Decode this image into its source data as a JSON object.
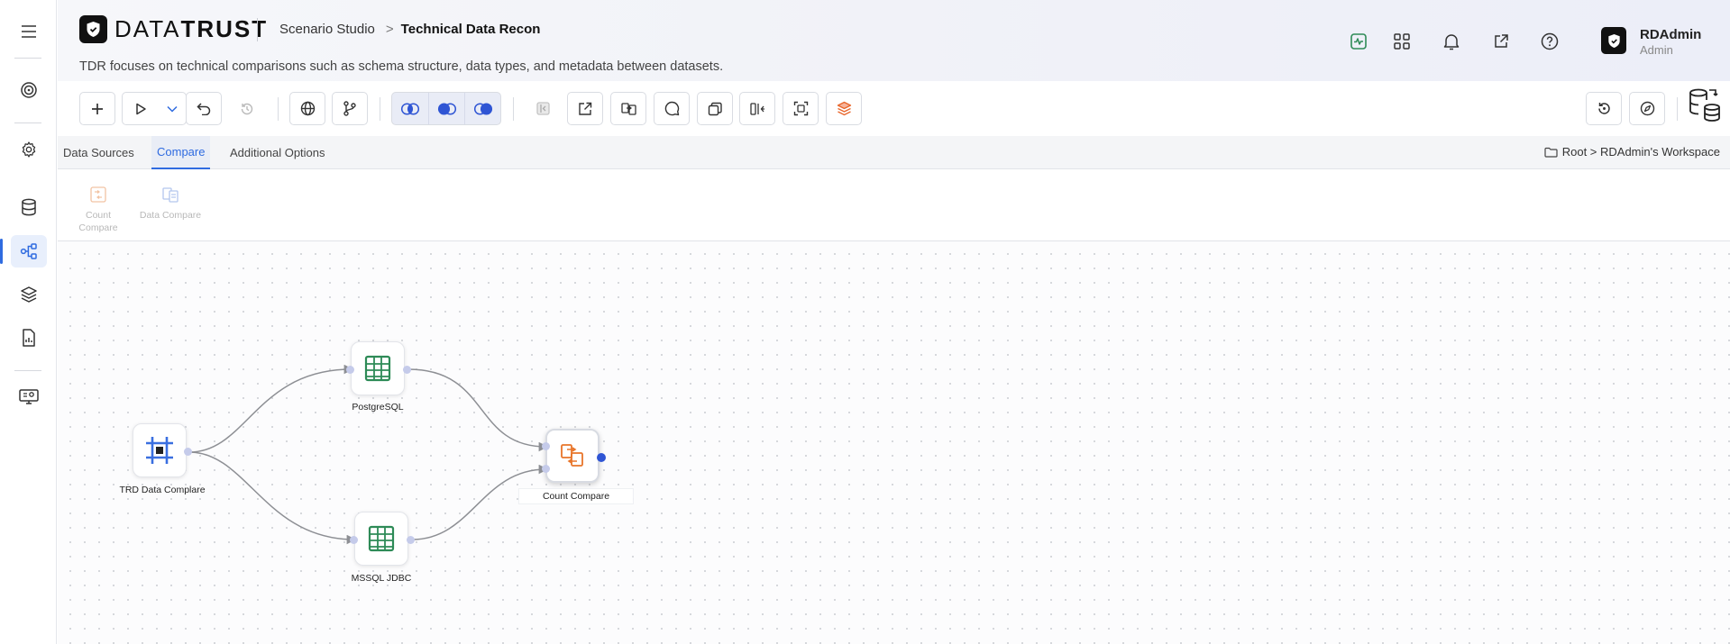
{
  "app": {
    "brand_light": "DATA",
    "brand_bold": "TRUST",
    "breadcrumb": [
      "Scenario Studio",
      "Technical Data Recon"
    ],
    "subtitle": "TDR focuses on technical comparisons such as schema structure, data types, and metadata between datasets."
  },
  "sidebar": {
    "items": [
      {
        "icon": "menu-icon"
      },
      {
        "icon": "target-icon"
      },
      {
        "icon": "gear-icon"
      },
      {
        "icon": "database-icon"
      },
      {
        "icon": "flow-icon",
        "active": true
      },
      {
        "icon": "layers-icon"
      },
      {
        "icon": "report-icon"
      },
      {
        "icon": "monitor-settings-icon"
      }
    ]
  },
  "header_icons": [
    "activity-icon",
    "grid-icon",
    "bell-icon",
    "external-link-icon",
    "help-icon"
  ],
  "user": {
    "name": "RDAdmin",
    "role": "Admin"
  },
  "tabs": [
    {
      "label": "Data Sources",
      "active": false
    },
    {
      "label": "Compare",
      "active": true
    },
    {
      "label": "Additional Options",
      "active": false
    }
  ],
  "workspace_path": "Root > RDAdmin's Workspace",
  "palette": [
    {
      "label": "Count Compare"
    },
    {
      "label": "Data Compare"
    }
  ],
  "nodes": [
    {
      "id": "trd",
      "label": "TRD Data Complare",
      "icon": "frame-icon"
    },
    {
      "id": "pg",
      "label": "PostgreSQL",
      "icon": "table-icon"
    },
    {
      "id": "mssql",
      "label": "MSSQL JDBC",
      "icon": "table-icon"
    },
    {
      "id": "cc",
      "label": "Count Compare",
      "icon": "compare-icon"
    }
  ],
  "colors": {
    "accent": "#2f6be0",
    "table_green": "#2e8b57",
    "compare_orange": "#e8752a",
    "frame_blue": "#3a6fe0"
  }
}
